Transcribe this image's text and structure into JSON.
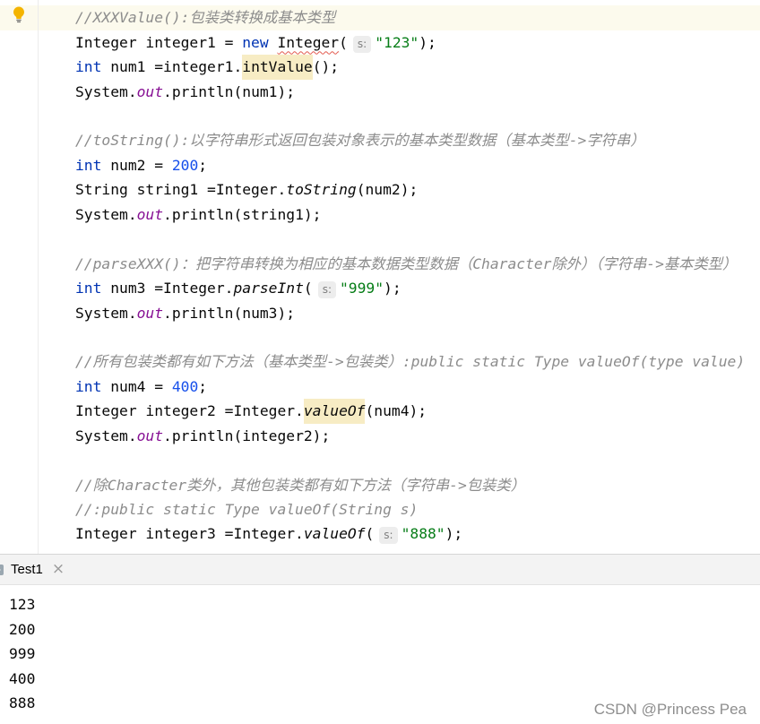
{
  "theme": {
    "keyword": "#0033b3",
    "number": "#1750eb",
    "string": "#067d17",
    "comment": "#8c8c8c",
    "field": "#871094",
    "usage_highlight": "#f7ecc4",
    "current_line": "#fcfaed",
    "error_underline": "#e35b4f",
    "watermark": "#8e8e8e"
  },
  "icons": {
    "gutter_intention": "lightbulb-icon",
    "run_tab": "run-config-icon",
    "run_tab_close": "close-icon"
  },
  "editor": {
    "lines": [
      {
        "current": true,
        "tokens": [
          {
            "k": "comment",
            "t": "//XXXValue():包装类转换成基本类型"
          }
        ]
      },
      {
        "tokens": [
          {
            "k": "plain",
            "t": "Integer integer1 = "
          },
          {
            "k": "keyword",
            "t": "new"
          },
          {
            "k": "plain",
            "t": " "
          },
          {
            "k": "deprecated",
            "t": "Integer"
          },
          {
            "k": "plain",
            "t": "("
          },
          {
            "k": "hint",
            "t": "s:"
          },
          {
            "k": "string",
            "t": "\"123\""
          },
          {
            "k": "plain",
            "t": ");"
          }
        ]
      },
      {
        "tokens": [
          {
            "k": "keyword",
            "t": "int"
          },
          {
            "k": "plain",
            "t": " num1 =integer1."
          },
          {
            "k": "usage",
            "t": "intValue"
          },
          {
            "k": "plain",
            "t": "();"
          }
        ]
      },
      {
        "tokens": [
          {
            "k": "plain",
            "t": "System."
          },
          {
            "k": "field",
            "t": "out"
          },
          {
            "k": "plain",
            "t": ".println(num1);"
          }
        ]
      },
      {
        "tokens": []
      },
      {
        "tokens": [
          {
            "k": "comment",
            "t": "//toString():以字符串形式返回包装对象表示的基本类型数据（基本类型->字符串）"
          }
        ]
      },
      {
        "tokens": [
          {
            "k": "keyword",
            "t": "int"
          },
          {
            "k": "plain",
            "t": " num2 = "
          },
          {
            "k": "number",
            "t": "200"
          },
          {
            "k": "plain",
            "t": ";"
          }
        ]
      },
      {
        "tokens": [
          {
            "k": "plain",
            "t": "String string1 =Integer."
          },
          {
            "k": "static",
            "t": "toString"
          },
          {
            "k": "plain",
            "t": "(num2);"
          }
        ]
      },
      {
        "tokens": [
          {
            "k": "plain",
            "t": "System."
          },
          {
            "k": "field",
            "t": "out"
          },
          {
            "k": "plain",
            "t": ".println(string1);"
          }
        ]
      },
      {
        "tokens": []
      },
      {
        "tokens": [
          {
            "k": "comment",
            "t": "//parseXXX()：把字符串转换为相应的基本数据类型数据（Character除外）（字符串->基本类型）"
          }
        ]
      },
      {
        "tokens": [
          {
            "k": "keyword",
            "t": "int"
          },
          {
            "k": "plain",
            "t": " num3 =Integer."
          },
          {
            "k": "static",
            "t": "parseInt"
          },
          {
            "k": "plain",
            "t": "("
          },
          {
            "k": "hint",
            "t": "s:"
          },
          {
            "k": "string",
            "t": "\"999\""
          },
          {
            "k": "plain",
            "t": ");"
          }
        ]
      },
      {
        "tokens": [
          {
            "k": "plain",
            "t": "System."
          },
          {
            "k": "field",
            "t": "out"
          },
          {
            "k": "plain",
            "t": ".println(num3);"
          }
        ]
      },
      {
        "tokens": []
      },
      {
        "tokens": [
          {
            "k": "comment",
            "t": "//所有包装类都有如下方法（基本类型->包装类）:public static Type valueOf(type value)"
          }
        ]
      },
      {
        "tokens": [
          {
            "k": "keyword",
            "t": "int"
          },
          {
            "k": "plain",
            "t": " num4 = "
          },
          {
            "k": "number",
            "t": "400"
          },
          {
            "k": "plain",
            "t": ";"
          }
        ]
      },
      {
        "tokens": [
          {
            "k": "plain",
            "t": "Integer integer2 =Integer."
          },
          {
            "k": "static-usage",
            "t": "valueOf"
          },
          {
            "k": "plain",
            "t": "(num4);"
          }
        ]
      },
      {
        "tokens": [
          {
            "k": "plain",
            "t": "System."
          },
          {
            "k": "field",
            "t": "out"
          },
          {
            "k": "plain",
            "t": ".println(integer2);"
          }
        ]
      },
      {
        "tokens": []
      },
      {
        "tokens": [
          {
            "k": "comment",
            "t": "//除Character类外，其他包装类都有如下方法（字符串->包装类）"
          }
        ]
      },
      {
        "tokens": [
          {
            "k": "comment",
            "t": "//:public static Type valueOf(String s)"
          }
        ]
      },
      {
        "tokens": [
          {
            "k": "plain",
            "t": "Integer integer3 =Integer."
          },
          {
            "k": "static",
            "t": "valueOf"
          },
          {
            "k": "plain",
            "t": "("
          },
          {
            "k": "hint",
            "t": "s:"
          },
          {
            "k": "string",
            "t": "\"888\""
          },
          {
            "k": "plain",
            "t": ");"
          }
        ]
      }
    ]
  },
  "run_panel": {
    "tab_label": "Test1",
    "close_glyph": "×"
  },
  "console": {
    "lines": [
      "123",
      "200",
      "999",
      "400",
      "888"
    ]
  },
  "watermark": "CSDN @Princess Pea"
}
